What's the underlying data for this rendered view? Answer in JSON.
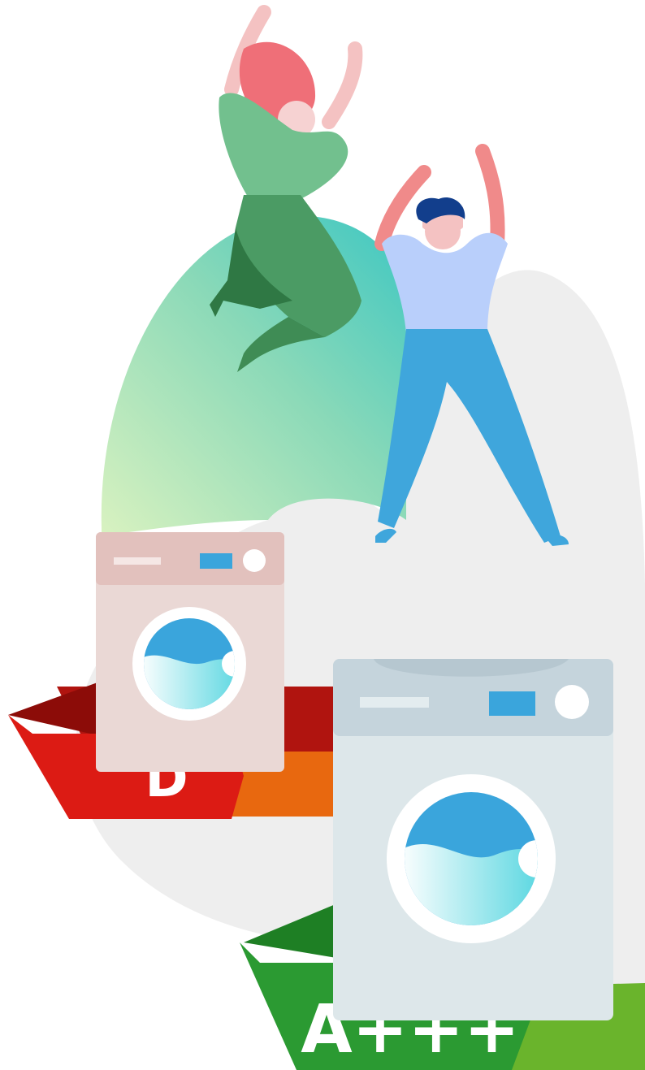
{
  "labels": {
    "old_rating": "D",
    "new_rating": "A+++"
  },
  "colors": {
    "background_blob": "#eeeeee",
    "gradient_start": "#d9f2c0",
    "gradient_end": "#3ec7c2",
    "rating_d_red": "#dc1b14",
    "rating_d_orange": "#e8680f",
    "rating_a_green": "#2b9a32",
    "rating_a_lightgreen": "#6ab42c",
    "old_washer_body": "#ead8d5",
    "old_washer_panel": "#e2c1bd",
    "new_washer_body": "#dde7ea",
    "new_washer_panel": "#c5d4dc",
    "water_blue": "#3aa5dc",
    "woman_shirt": "#72c08e",
    "woman_pants": "#4b9b64",
    "woman_hair": "#ef6f78",
    "man_shirt": "#b9cffb",
    "man_pants": "#3fa6dc",
    "man_hair": "#123e8c",
    "skin": "#f4c2c2"
  },
  "icons": [
    "old-washing-machine-icon",
    "new-washing-machine-icon",
    "jumping-woman-illustration",
    "jumping-man-illustration"
  ]
}
